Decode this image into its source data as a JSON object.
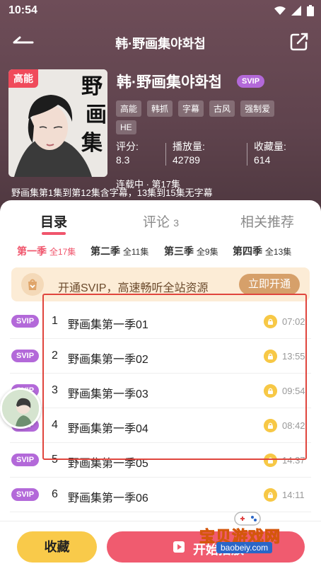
{
  "status_bar": {
    "time": "10:54"
  },
  "nav": {
    "title": "韩·野画集야화첩"
  },
  "book": {
    "cover_tag": "高能",
    "cover_title": "野画集",
    "title": "韩·野画集야화첩",
    "badge": "SVIP",
    "tags": [
      "高能",
      "韩抓",
      "字幕",
      "古风",
      "强制爱",
      "HE"
    ],
    "stats": [
      {
        "label": "评分:",
        "value": "8.3"
      },
      {
        "label": "播放量:",
        "value": "42789"
      },
      {
        "label": "收藏量:",
        "value": "614"
      }
    ],
    "serial_status": "连载中 · 第17集",
    "description": "野画集第1集到第12集含字幕，13集到15集无字幕"
  },
  "tabs": [
    {
      "label": "目录",
      "count": ""
    },
    {
      "label": "评论",
      "count": "3"
    },
    {
      "label": "相关推荐",
      "count": ""
    }
  ],
  "seasons": [
    {
      "name": "第一季",
      "count": "全17集"
    },
    {
      "name": "第二季",
      "count": "全11集"
    },
    {
      "name": "第三季",
      "count": "全9集"
    },
    {
      "name": "第四季",
      "count": "全13集"
    }
  ],
  "promo": {
    "text": "开通SVIP，高速畅听全站资源",
    "button": "立即开通"
  },
  "episodes": [
    {
      "badge": "SVIP",
      "num": "1",
      "title": "野画集第一季01",
      "duration": "07:02"
    },
    {
      "badge": "SVIP",
      "num": "2",
      "title": "野画集第一季02",
      "duration": "13:55"
    },
    {
      "badge": "SVIP",
      "num": "3",
      "title": "野画集第一季03",
      "duration": "09:54"
    },
    {
      "badge": "SVIP",
      "num": "4",
      "title": "野画集第一季04",
      "duration": "08:42"
    },
    {
      "badge": "SVIP",
      "num": "5",
      "title": "野画集第一季05",
      "duration": "14:37"
    },
    {
      "badge": "SVIP",
      "num": "6",
      "title": "野画集第一季06",
      "duration": "14:11"
    }
  ],
  "bottom": {
    "favorite": "收藏",
    "play": "开始播放"
  },
  "watermark": {
    "text": "宝贝游戏网",
    "url": "baobeiy.com"
  },
  "colors": {
    "accent": "#f0556c",
    "svip": "#b369d9",
    "hero": "#5f434d",
    "favorite": "#f9ca4a"
  }
}
